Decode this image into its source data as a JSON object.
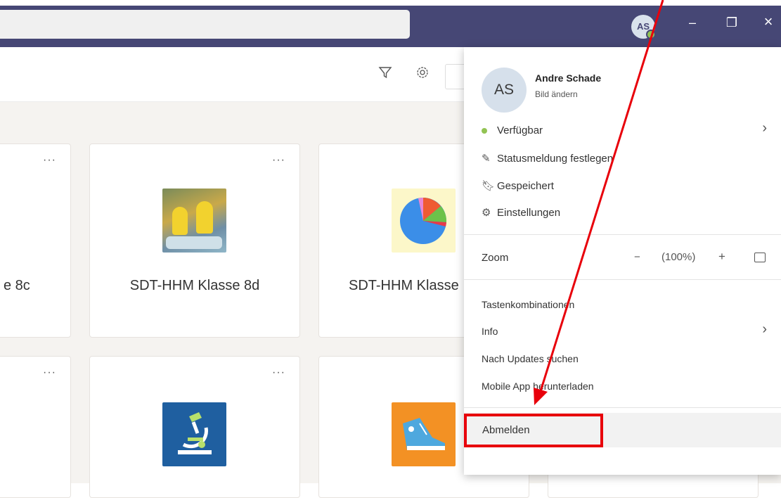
{
  "titlebar": {
    "avatar_initials": "AS",
    "minimize": "–",
    "restore": "❐",
    "close": "×"
  },
  "toolbar": {
    "filter_icon": "filter-icon",
    "gear_icon": "gear-icon"
  },
  "cards": [
    {
      "title": "e 8c"
    },
    {
      "title": "SDT-HHM Klasse 8d"
    },
    {
      "title": "SDT-HHM Klasse"
    }
  ],
  "card_more": "···",
  "menu": {
    "avatar_initials": "AS",
    "user_name": "Andre Schade",
    "change_picture": "Bild ändern",
    "status": "Verfügbar",
    "status_message": "Statusmeldung festlegen",
    "saved": "Gespeichert",
    "settings": "Einstellungen",
    "zoom_label": "Zoom",
    "zoom_minus": "−",
    "zoom_value": "(100%)",
    "zoom_plus": "+",
    "shortcuts": "Tastenkombinationen",
    "info": "Info",
    "check_updates": "Nach Updates suchen",
    "mobile_app": "Mobile App herunterladen",
    "sign_out": "Abmelden",
    "chevron": "›"
  },
  "colors": {
    "titlebar": "#464775",
    "available": "#92c353",
    "highlight": "#e8000b"
  }
}
